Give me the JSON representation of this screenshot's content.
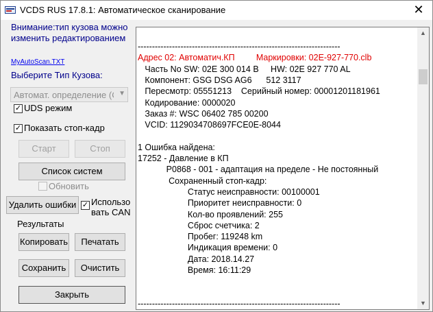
{
  "window": {
    "title": "VCDS RUS 17.8.1:  Автоматическое сканирование",
    "close_glyph": "✕"
  },
  "left": {
    "warning": "Внимание:тип кузова можно изменить редактированием",
    "autoscan_link": "MyAutoScan.TXT",
    "body_type_label": "Выберите Тип Кузова:",
    "body_type_select": "Автомат. определение (С",
    "uds_mode": {
      "label": "UDS режим",
      "checked": true
    },
    "show_freeze_frame": {
      "label": "Показать стоп-кадр",
      "checked": true
    },
    "start_label": "Старт",
    "stop_label": "Стоп",
    "system_list_label": "Список систем",
    "refresh": {
      "label": "Обновить",
      "checked": false
    },
    "clear_errors_label": "Удалить ошибки",
    "use_can": {
      "label_line1": "Использо",
      "label_line2": "вать CAN",
      "checked": true
    },
    "results_label": "Результаты",
    "copy_label": "Копировать",
    "print_label": "Печатать",
    "save_label": "Сохранить",
    "clear_label": "Очистить",
    "close_label": "Закрыть"
  },
  "report": {
    "lines": [
      {
        "text": "-----------------------------------------------------------------------",
        "color": "black"
      },
      {
        "text": "Адрес 02: Автоматич.КП         Маркировки: 02E-927-770.clb",
        "color": "red"
      },
      {
        "text": "   Часть No SW: 02E 300 014 B     HW: 02E 927 770 AL",
        "color": "black"
      },
      {
        "text": "   Компонент: GSG DSG AG6      512 3117",
        "color": "black"
      },
      {
        "text": "   Пересмотр: 05551213    Серийный номер: 00001201181961",
        "color": "black"
      },
      {
        "text": "   Кодирование: 0000020",
        "color": "black"
      },
      {
        "text": "   Заказ #: WSC 06402 785 00200",
        "color": "black"
      },
      {
        "text": "   VCID: 1129034708697FCE0E-8044",
        "color": "black"
      },
      {
        "text": "",
        "color": "black"
      },
      {
        "text": "1 Ошибка найдена:",
        "color": "black"
      },
      {
        "text": "17252 - Давление в КП",
        "color": "black"
      },
      {
        "text": "            P0868 - 001 - адаптация на пределе - Не постоянный",
        "color": "black"
      },
      {
        "text": "             Сохраненный стоп-кадр:",
        "color": "black"
      },
      {
        "text": "                     Статус неисправности: 00100001",
        "color": "black"
      },
      {
        "text": "                     Приоритет неисправности: 0",
        "color": "black"
      },
      {
        "text": "                     Кол-во проявлений: 255",
        "color": "black"
      },
      {
        "text": "                     Сброс счетчика: 2",
        "color": "black"
      },
      {
        "text": "                     Пробег: 119248 km",
        "color": "black"
      },
      {
        "text": "                     Индикация времени: 0",
        "color": "black"
      },
      {
        "text": "                     Дата: 2018.14.27",
        "color": "black"
      },
      {
        "text": "                     Время: 16:11:29",
        "color": "black"
      },
      {
        "text": "",
        "color": "black"
      },
      {
        "text": "",
        "color": "black"
      },
      {
        "text": "-----------------------------------------------------------------------",
        "color": "black"
      }
    ],
    "scroll_up_glyph": "▲",
    "scroll_down_glyph": "▼"
  }
}
